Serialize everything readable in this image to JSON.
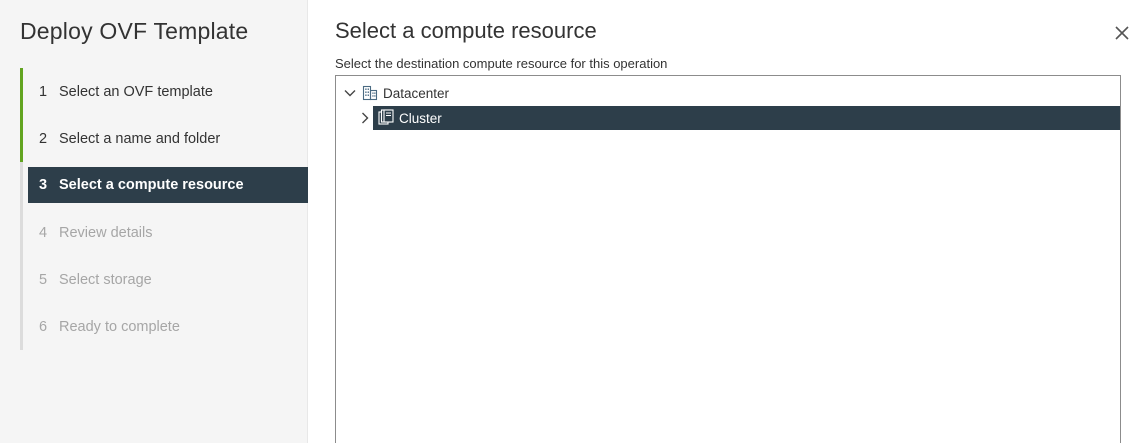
{
  "wizard": {
    "title": "Deploy OVF Template",
    "steps": [
      {
        "number": "1",
        "label": "Select an OVF template",
        "state": "done"
      },
      {
        "number": "2",
        "label": "Select a name and folder",
        "state": "done"
      },
      {
        "number": "3",
        "label": "Select a compute resource",
        "state": "active"
      },
      {
        "number": "4",
        "label": "Review details",
        "state": "pending"
      },
      {
        "number": "5",
        "label": "Select storage",
        "state": "pending"
      },
      {
        "number": "6",
        "label": "Ready to complete",
        "state": "pending"
      }
    ]
  },
  "page": {
    "title": "Select a compute resource",
    "subtitle": "Select the destination compute resource for this operation",
    "close_icon": "close-icon"
  },
  "tree": {
    "nodes": [
      {
        "label": "Datacenter",
        "icon": "datacenter-icon",
        "expanded": true,
        "selected": false
      },
      {
        "label": "Cluster",
        "icon": "cluster-icon",
        "expanded": false,
        "selected": true
      }
    ]
  },
  "colors": {
    "accent_done": "#62a420",
    "active_bg": "#2d3e4a",
    "pending_text": "#a6a6a6"
  }
}
